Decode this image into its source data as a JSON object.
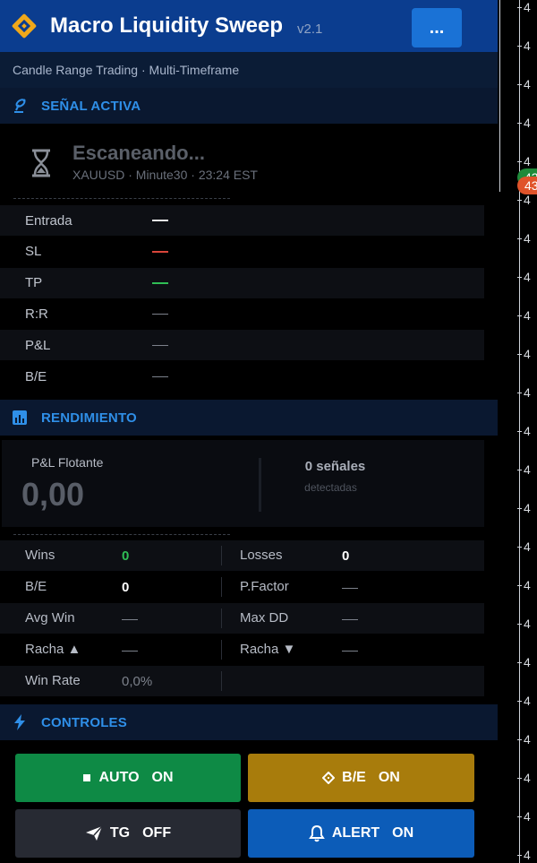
{
  "app": {
    "title": "Macro Liquidity Sweep",
    "version": "v2.1",
    "menu_label": "...",
    "subtitle": "Candle Range Trading · Multi-Timeframe"
  },
  "signal_section": {
    "header": "SEÑAL ACTIVA",
    "status_title": "Escaneando...",
    "status_detail": "XAUUSD · Minute30 · 23:24 EST",
    "rows": [
      {
        "label": "Entrada",
        "dash_color": "#e8e8e8"
      },
      {
        "label": "SL",
        "dash_color": "#d9453a"
      },
      {
        "label": "TP",
        "dash_color": "#2fbd55"
      },
      {
        "label": "R:R",
        "dash_color": "#7c818b"
      },
      {
        "label": "P&L",
        "dash_color": "#7c818b"
      },
      {
        "label": "B/E",
        "dash_color": "#7c818b"
      }
    ]
  },
  "performance_section": {
    "header": "RENDIMIENTO",
    "pnl_label": "P&L Flotante",
    "pnl_value": "0,00",
    "signals_count": "0 señales",
    "signals_sub": "detectadas",
    "stats": [
      {
        "left_label": "Wins",
        "left_value": "0",
        "left_color": "#2fbd55",
        "right_label": "Losses",
        "right_value": "0",
        "right_color": "#ffffff"
      },
      {
        "left_label": "B/E",
        "left_value": "0",
        "left_color": "#ffffff",
        "right_label": "P.Factor",
        "right_value": "",
        "right_color": ""
      },
      {
        "left_label": "Avg Win",
        "left_value": "",
        "left_color": "",
        "right_label": "Max DD",
        "right_value": "",
        "right_color": ""
      },
      {
        "left_label": "Racha ▲",
        "left_value": "",
        "left_color": "",
        "right_label": "Racha ▼",
        "right_value": "",
        "right_color": ""
      },
      {
        "left_label": "Win Rate",
        "left_value": "0,0%",
        "left_color": "#7c818b",
        "right_label": "",
        "right_value": "",
        "right_color": ""
      }
    ]
  },
  "controls_section": {
    "header": "CONTROLES",
    "buttons": [
      {
        "label": "AUTO",
        "state": "ON",
        "color": "#0e8a45",
        "icon": "square-icon"
      },
      {
        "label": "B/E",
        "state": "ON",
        "color": "#a87c0c",
        "icon": "diamond-icon"
      },
      {
        "label": "TG",
        "state": "OFF",
        "color": "#272a33",
        "icon": "plane-icon"
      },
      {
        "label": "ALERT",
        "state": "ON",
        "color": "#0c5cb8",
        "icon": "bell-icon"
      }
    ]
  },
  "chart_axis": {
    "tick_label": "4",
    "price_tag_green": "43",
    "price_tag_red": "43"
  },
  "colors": {
    "accent": "#2f8fe8",
    "title_bar": "#0b3d8f",
    "menu_button": "#1a72d6"
  }
}
